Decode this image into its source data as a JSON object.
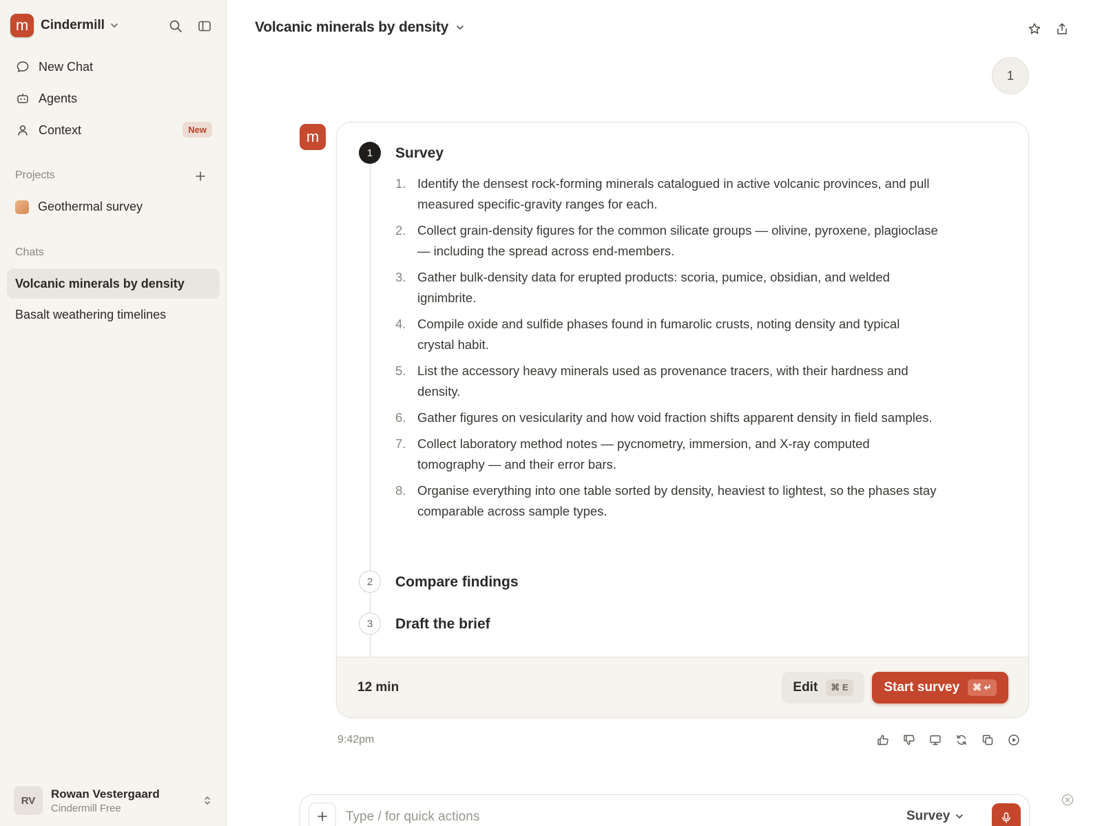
{
  "app": {
    "name": "Cindermill",
    "logo_glyph": "m",
    "accent": "#c4462c"
  },
  "sidebar": {
    "nav": [
      {
        "label": "New Chat",
        "icon": "chat-bubble-icon"
      },
      {
        "label": "Agents",
        "icon": "robot-icon"
      },
      {
        "label": "Context",
        "icon": "person-icon",
        "badge": "New"
      }
    ],
    "projects_label": "Projects",
    "projects": [
      {
        "label": "Geothermal survey"
      }
    ],
    "chats_label": "Chats",
    "chats": [
      {
        "label": "Volcanic minerals by density",
        "active": true
      },
      {
        "label": "Basalt weathering timelines",
        "active": false
      }
    ],
    "user": {
      "initials": "RV",
      "name": "Rowan Vestergaard",
      "plan": "Cindermill Free"
    }
  },
  "header": {
    "title": "Volcanic minerals by density"
  },
  "conversation": {
    "user_message": "1",
    "plan": {
      "steps": [
        {
          "number": "1",
          "title": "Survey",
          "tasks": [
            {
              "num": "1.",
              "text": "Identify the densest rock-forming minerals catalogued in active volcanic provinces, and pull measured specific-gravity ranges for each."
            },
            {
              "num": "2.",
              "text": "Collect grain-density figures for the common silicate groups — olivine, pyroxene, plagioclase — including the spread across end-members."
            },
            {
              "num": "3.",
              "text": "Gather bulk-density data for erupted products: scoria, pumice, obsidian, and welded ignimbrite."
            },
            {
              "num": "4.",
              "text": "Compile oxide and sulfide phases found in fumarolic crusts, noting density and typical crystal habit."
            },
            {
              "num": "5.",
              "text": "List the accessory heavy minerals used as provenance tracers, with their hardness and density."
            },
            {
              "num": "6.",
              "text": "Gather figures on vesicularity and how void fraction shifts apparent density in field samples."
            },
            {
              "num": "7.",
              "text": "Collect laboratory method notes — pycnometry, immersion, and X-ray computed tomography — and their error bars."
            },
            {
              "num": "8.",
              "text": "Organise everything into one table sorted by density, heaviest to lightest, so the phases stay comparable across sample types."
            }
          ]
        },
        {
          "number": "2",
          "title": "Compare findings"
        },
        {
          "number": "3",
          "title": "Draft the brief"
        }
      ],
      "duration": "12 min",
      "edit_label": "Edit",
      "edit_shortcut": "⌘ E",
      "start_label": "Start survey",
      "start_shortcut": "⌘ ↵"
    },
    "timestamp": "9:42pm"
  },
  "composer": {
    "placeholder": "Type / for quick actions",
    "mode": "Survey"
  }
}
